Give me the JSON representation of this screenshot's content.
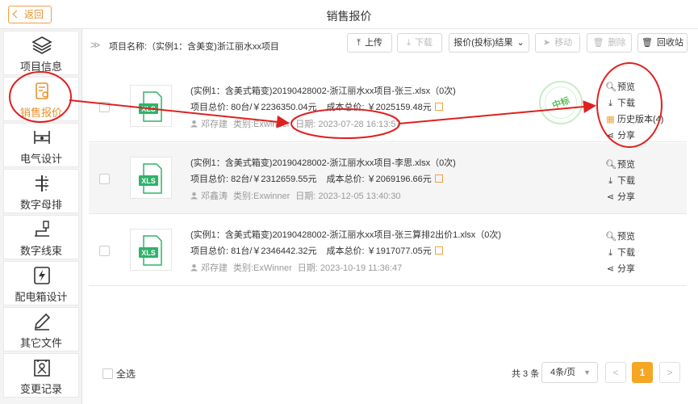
{
  "header": {
    "back_label": "返回",
    "title": "销售报价"
  },
  "sidebar": {
    "items": [
      {
        "label": "项目信息",
        "icon": "layers-icon"
      },
      {
        "label": "销售报价",
        "icon": "quote-document-icon",
        "active": true
      },
      {
        "label": "电气设计",
        "icon": "electrical-icon"
      },
      {
        "label": "数字母排",
        "icon": "busbar-icon"
      },
      {
        "label": "数字线束",
        "icon": "wire-harness-icon"
      },
      {
        "label": "配电箱设计",
        "icon": "lightning-box-icon"
      },
      {
        "label": "其它文件",
        "icon": "pen-icon"
      },
      {
        "label": "变更记录",
        "icon": "record-icon"
      }
    ]
  },
  "toolbar": {
    "breadcrumb": "项目名称:（实例1：含美变)浙江丽水xx项目",
    "upload": "上传",
    "download": "下载",
    "quote_result": "报价(投标)结果",
    "move": "移动",
    "delete": "删除",
    "recycle": "回收站"
  },
  "files": [
    {
      "name": "(实例1：含美式箱变)20190428002-浙江丽水xx项目-张三.xlsx（0次)",
      "total_price": "项目总价: 80台/￥2236350.04元",
      "cost_price": "成本总价: ￥2025159.48元",
      "author": "邓存建",
      "category": "类别:Exwinner",
      "date": "日期: 2023-07-28 16:13:57",
      "thumb_label": "XLS",
      "stamp": "中标",
      "actions": [
        "预览",
        "下载",
        "历史版本(4)",
        "分享"
      ]
    },
    {
      "name": "(实例1：含美式箱变)20190428002-浙江丽水xx项目-李思.xlsx（0次)",
      "total_price": "项目总价: 82台/￥2312659.55元",
      "cost_price": "成本总价: ￥2069196.66元",
      "author": "邓鑫涛",
      "category": "类别:Exwinner",
      "date": "日期: 2023-12-05 13:40:30",
      "thumb_label": "XLS",
      "actions": [
        "预览",
        "下载",
        "分享"
      ]
    },
    {
      "name": "(实例1：含美式箱变)20190428002-浙江丽水xx项目-张三算排2出价1.xlsx（0次)",
      "total_price": "项目总价: 81台/￥2346442.32元",
      "cost_price": "成本总价: ￥1917077.05元",
      "author": "邓存建",
      "category": "类别:ExWinner",
      "date": "日期: 2023-10-19 11:36:47",
      "thumb_label": "XLS",
      "actions": [
        "预览",
        "下载",
        "分享"
      ]
    }
  ],
  "footer": {
    "select_all": "全选",
    "total": "共 3 条",
    "page_size": "4条/页",
    "prev": "<",
    "current_page": "1",
    "next": ">"
  },
  "colors": {
    "accent": "#f5a623",
    "annotation_red": "#e02020",
    "xls_green": "#2fb36b"
  }
}
